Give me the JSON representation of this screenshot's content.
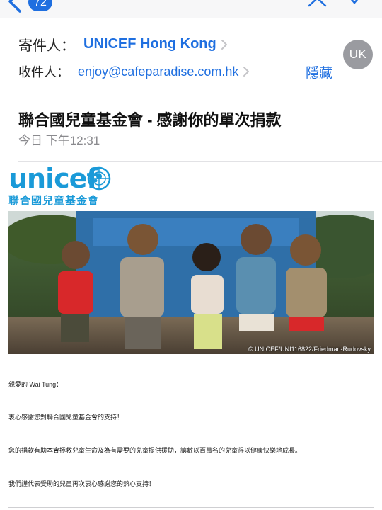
{
  "nav": {
    "message_count": "72"
  },
  "header": {
    "from_label": "寄件人：",
    "from_name": "UNICEF Hong Kong",
    "to_label": "收件人：",
    "to_address": "enjoy@cafeparadise.com.hk",
    "hide_label": "隱藏",
    "avatar_initials": "UK"
  },
  "message": {
    "subject": "聯合國兒童基金會 - 感謝你的單次捐款",
    "datetime": "今日 下午12:31"
  },
  "logo": {
    "word": "unicef",
    "subtitle": "聯合國兒童基金會"
  },
  "photo": {
    "credit": "© UNICEF/UNI116822/Friedman-Rudovsky"
  },
  "body": {
    "greeting": "親愛的 Wai Tung：",
    "para1": "衷心感謝您對聯合國兒童基金會的支持！",
    "para2": "您的捐款有助本會拯救兒童生命及為有需要的兒童提供援助，讓數以百萬名的兒童得以健康快樂地成長。",
    "para3": "我們謹代表受助的兒童再次衷心感謝您的熱心支持！"
  },
  "colors": {
    "accent": "#1f6fe0",
    "unicef_blue": "#1a9ad8",
    "secondary_text": "#8a8a8e"
  }
}
